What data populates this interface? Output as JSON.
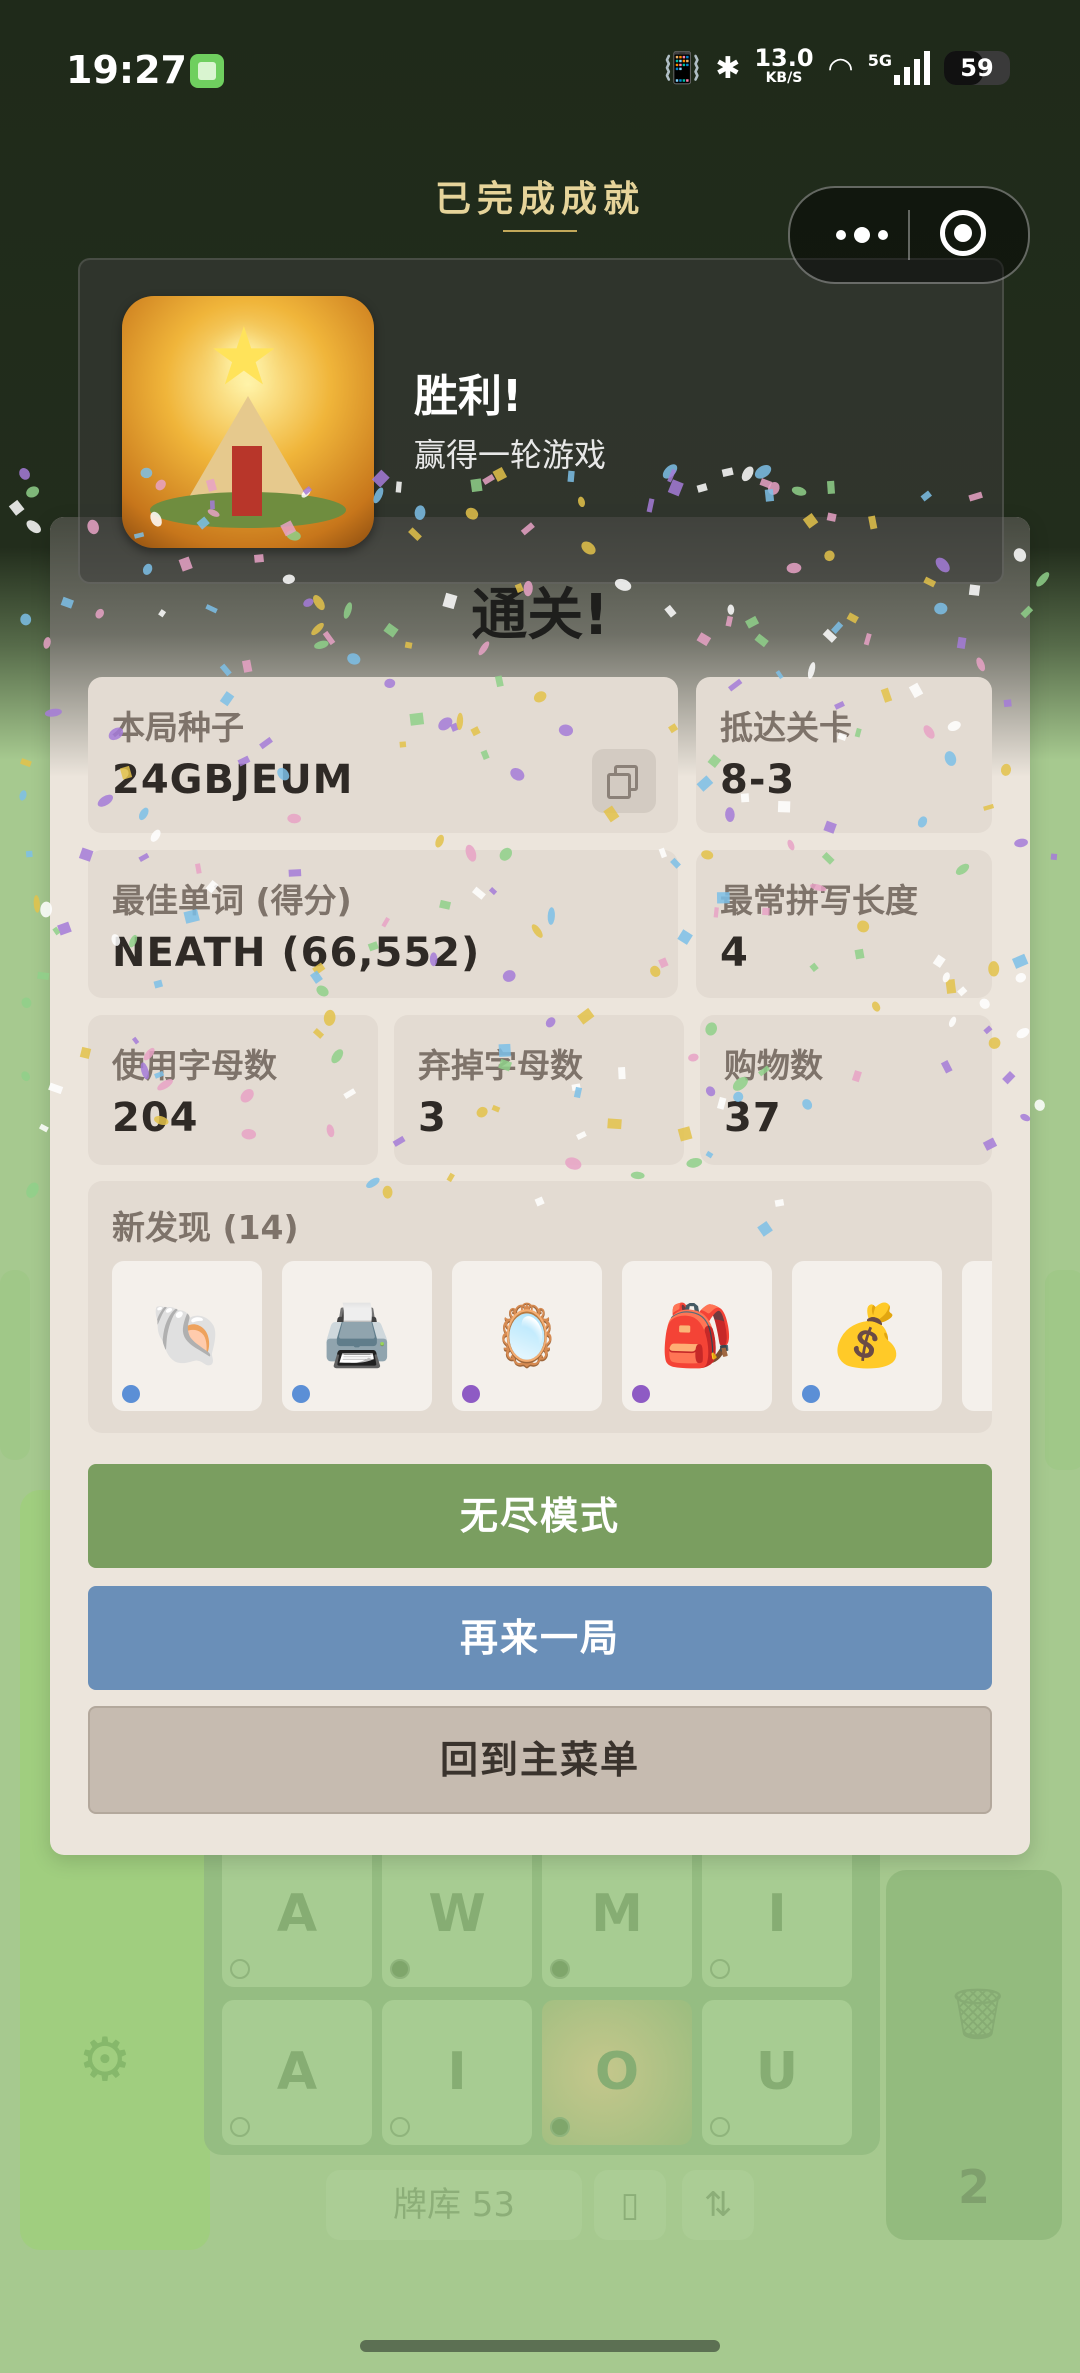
{
  "status_bar": {
    "time": "19:27",
    "net_speed_top": "13.0",
    "net_speed_unit": "KB/S",
    "network_type": "5G",
    "battery": "59",
    "battery_level": 0.59
  },
  "background_game": {
    "tiles": [
      {
        "letter": "A",
        "dot": "empty"
      },
      {
        "letter": "W",
        "dot": "filled"
      },
      {
        "letter": "M",
        "dot": "filled"
      },
      {
        "letter": "I",
        "dot": "empty"
      },
      {
        "letter": "A",
        "dot": "empty"
      },
      {
        "letter": "I",
        "dot": "empty"
      },
      {
        "letter": "O",
        "dot": "filled",
        "active": true
      },
      {
        "letter": "U",
        "dot": "empty"
      }
    ],
    "deck_label": "牌库 53",
    "discard_count": "2"
  },
  "achievement": {
    "title": "已完成成就",
    "heading": "胜利!",
    "description": "赢得一轮游戏"
  },
  "results": {
    "title": "通关!",
    "seed_label": "本局种子",
    "seed_value": "24GBJEUM",
    "level_label": "抵达关卡",
    "level_value": "8-3",
    "best_word_label": "最佳单词 (得分)",
    "best_word_value": "NEATH (66,552)",
    "common_length_label": "最常拼写长度",
    "common_length_value": "4",
    "letters_used_label": "使用字母数",
    "letters_used_value": "204",
    "letters_discarded_label": "弃掉字母数",
    "letters_discarded_value": "3",
    "purchases_label": "购物数",
    "purchases_value": "37",
    "discoveries_label": "新发现 (14)",
    "discoveries": [
      {
        "icon": "🐚",
        "icon_name": "shell-icon",
        "rarity_color": "#5b8fd6"
      },
      {
        "icon": "🖨️",
        "icon_name": "printer-icon",
        "rarity_color": "#5b8fd6"
      },
      {
        "icon": "🪞",
        "icon_name": "mirror-icon",
        "rarity_color": "#8e5bc4"
      },
      {
        "icon": "🎒",
        "icon_name": "backpack-icon",
        "rarity_color": "#8e5bc4"
      },
      {
        "icon": "💰",
        "icon_name": "money-bag-icon",
        "rarity_color": "#5b8fd6"
      }
    ]
  },
  "buttons": {
    "endless": "无尽模式",
    "play_again": "再来一局",
    "main_menu": "回到主菜单"
  },
  "colors": {
    "endless": "#7a9e60",
    "play_again": "#6a8fb8",
    "main_menu": "#c6bbb0",
    "panel": "#ece5dc",
    "achievement_title": "#e6d49a"
  }
}
